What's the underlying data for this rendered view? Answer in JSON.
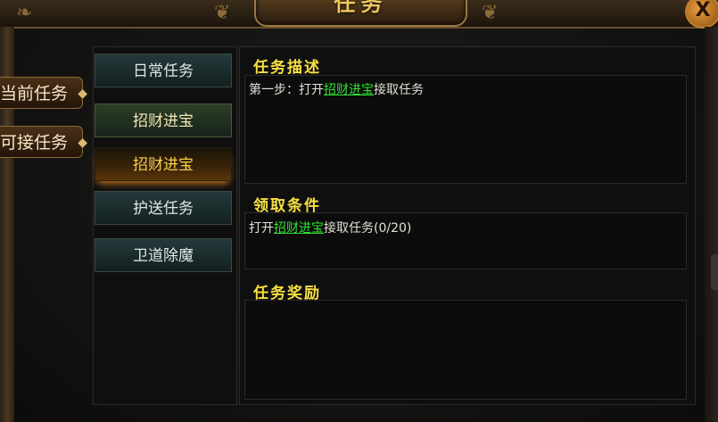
{
  "window": {
    "title": "任务",
    "close_label": "X"
  },
  "side_tabs": [
    {
      "label": "当前任务"
    },
    {
      "label": "可接任务"
    }
  ],
  "categories": [
    {
      "label": "日常任务"
    },
    {
      "label": "招财进宝"
    },
    {
      "label": "招财进宝"
    },
    {
      "label": "护送任务"
    },
    {
      "label": "卫道除魔"
    }
  ],
  "description": {
    "title": "任务描述",
    "prefix": "第一步：打开",
    "link": "招财进宝",
    "suffix": "接取任务"
  },
  "requirements": {
    "title": "领取条件",
    "prefix": "打开",
    "link": "招财进宝",
    "suffix": "接取任务(0/20)"
  },
  "rewards": {
    "title": "任务奖励"
  },
  "colors": {
    "title_gold": "#f0c860",
    "section_yellow": "#f8e040",
    "link_green": "#30e030",
    "selected_gold": "#f8d050"
  }
}
